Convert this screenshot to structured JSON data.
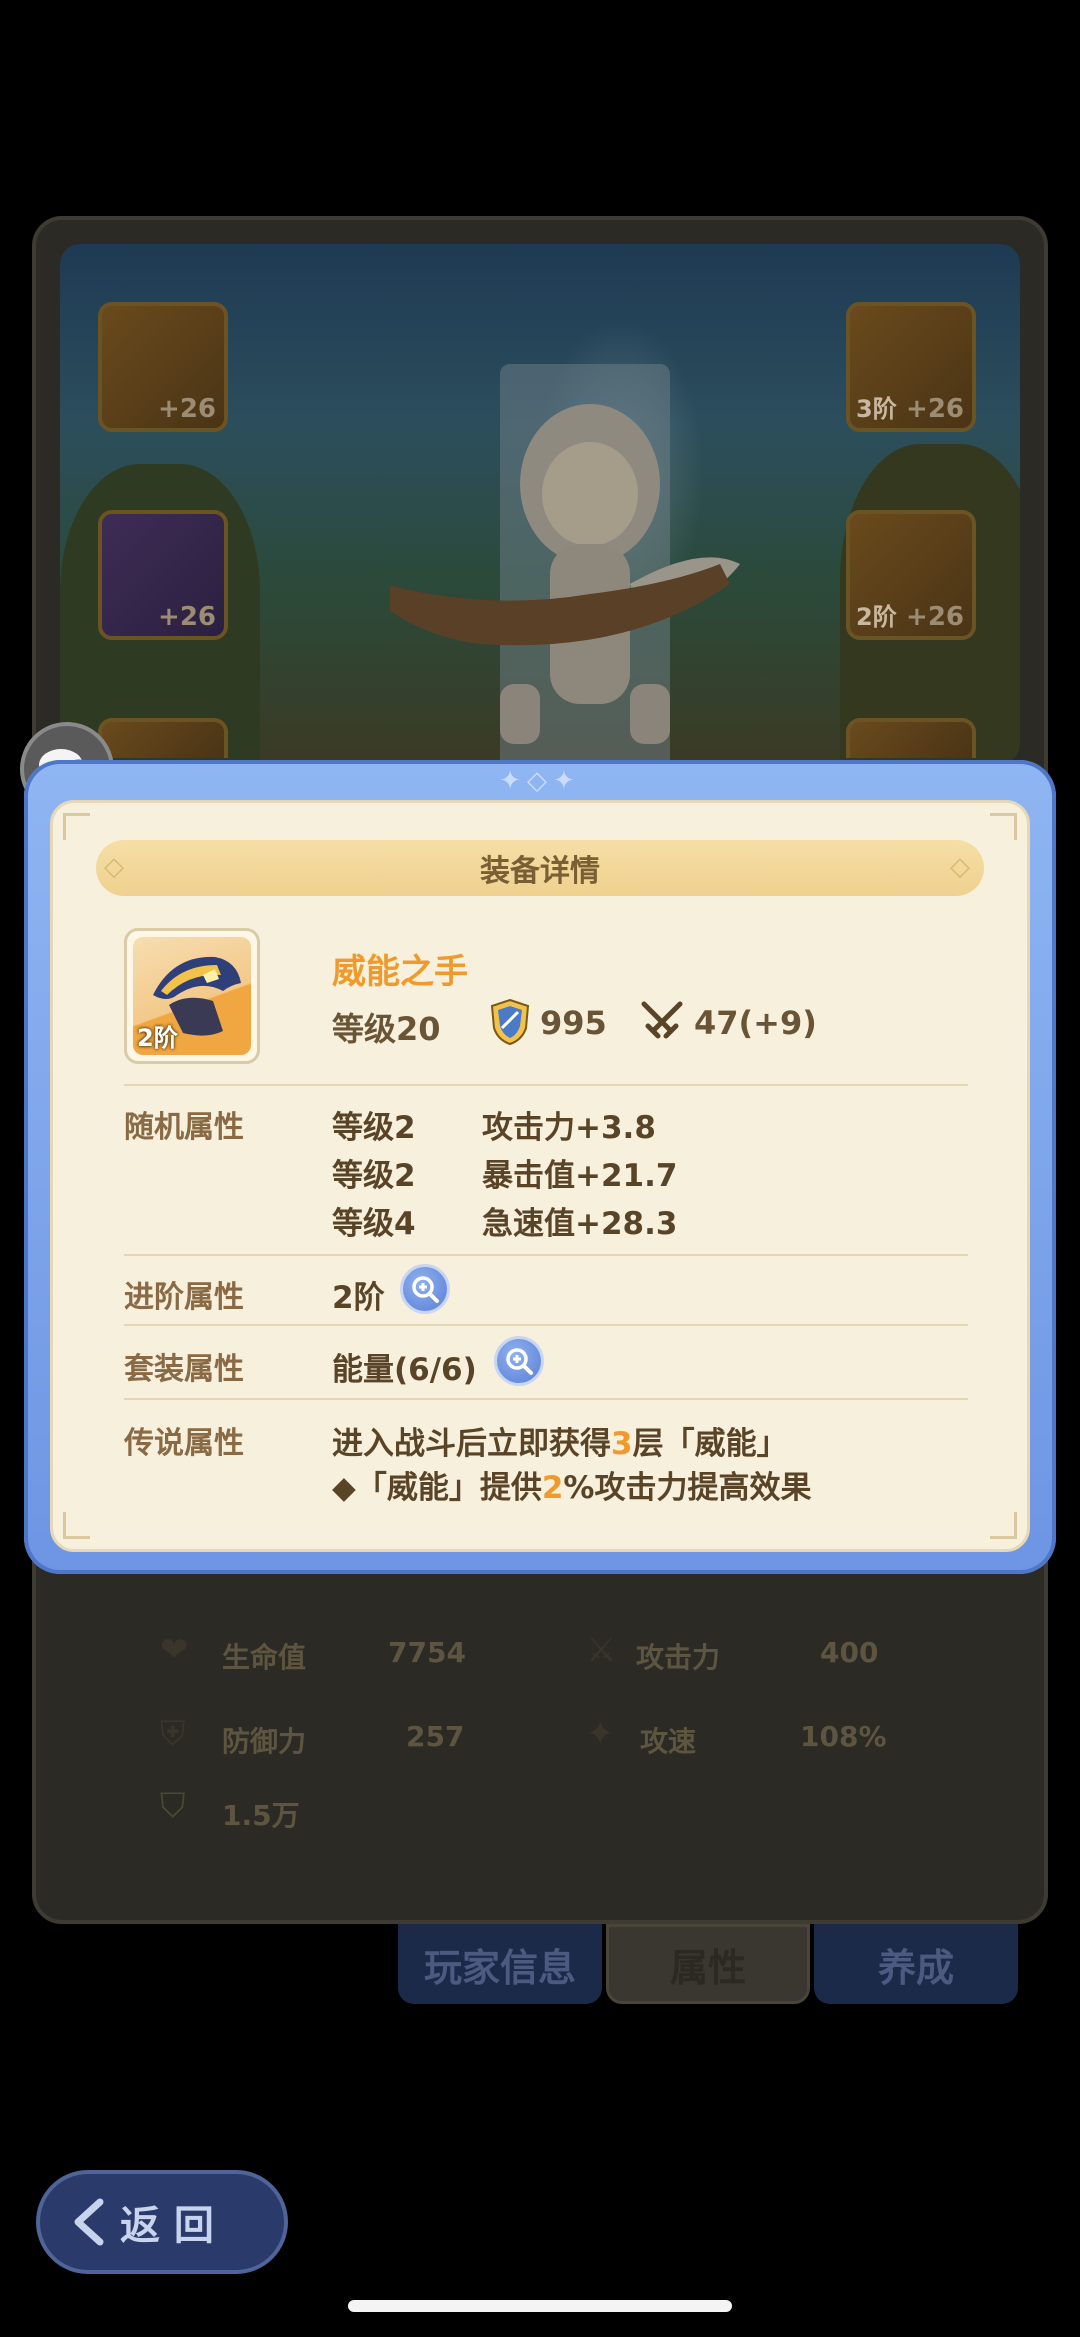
{
  "equipment_slots": [
    {
      "level": "+26",
      "tier": ""
    },
    {
      "level": "+26",
      "tier": "3阶"
    },
    {
      "level": "+26",
      "tier": ""
    },
    {
      "level": "+26",
      "tier": "2阶"
    }
  ],
  "stats": {
    "hp_label": "生命值",
    "hp_value": "7754",
    "atk_label": "攻击力",
    "atk_value": "400",
    "def_label": "防御力",
    "def_value": "257",
    "speed_label": "攻速",
    "speed_value": "108%",
    "power_value": "1.5万",
    "section_title": "属性"
  },
  "tabs": [
    "玩家信息",
    "属性",
    "养成"
  ],
  "modal": {
    "title": "装备详情",
    "item": {
      "name": "威能之手",
      "tier": "2阶",
      "level": "等级20",
      "power": "995",
      "attack": "47(+9)"
    },
    "random_attrs": {
      "label": "随机属性",
      "rows": [
        {
          "level": "等级2",
          "attr": "攻击力+3.8"
        },
        {
          "level": "等级2",
          "attr": "暴击值+21.7"
        },
        {
          "level": "等级4",
          "attr": "急速值+28.3"
        }
      ]
    },
    "advance": {
      "label": "进阶属性",
      "value": "2阶"
    },
    "set": {
      "label": "套装属性",
      "value": "能量(6/6)"
    },
    "legend": {
      "label": "传说属性",
      "line1_a": "进入战斗后立即获得",
      "line1_num": "3",
      "line1_b": "层「威能」",
      "line2_a": "◆「威能」提供",
      "line2_num": "2",
      "line2_b": "%攻击力提高效果"
    }
  },
  "back_button": "返 回",
  "icons": {
    "chat": "chat-icon",
    "shield": "shield-icon",
    "swords": "crossed-swords-icon",
    "zoom": "zoom-in-icon",
    "heart": "heart-icon",
    "speed": "speed-icon",
    "back_arrow": "back-arrow-icon"
  },
  "colors": {
    "accent_orange": "#ef9a2b",
    "frame_blue": "#6d95e3",
    "parchment": "#f7f0dd"
  }
}
